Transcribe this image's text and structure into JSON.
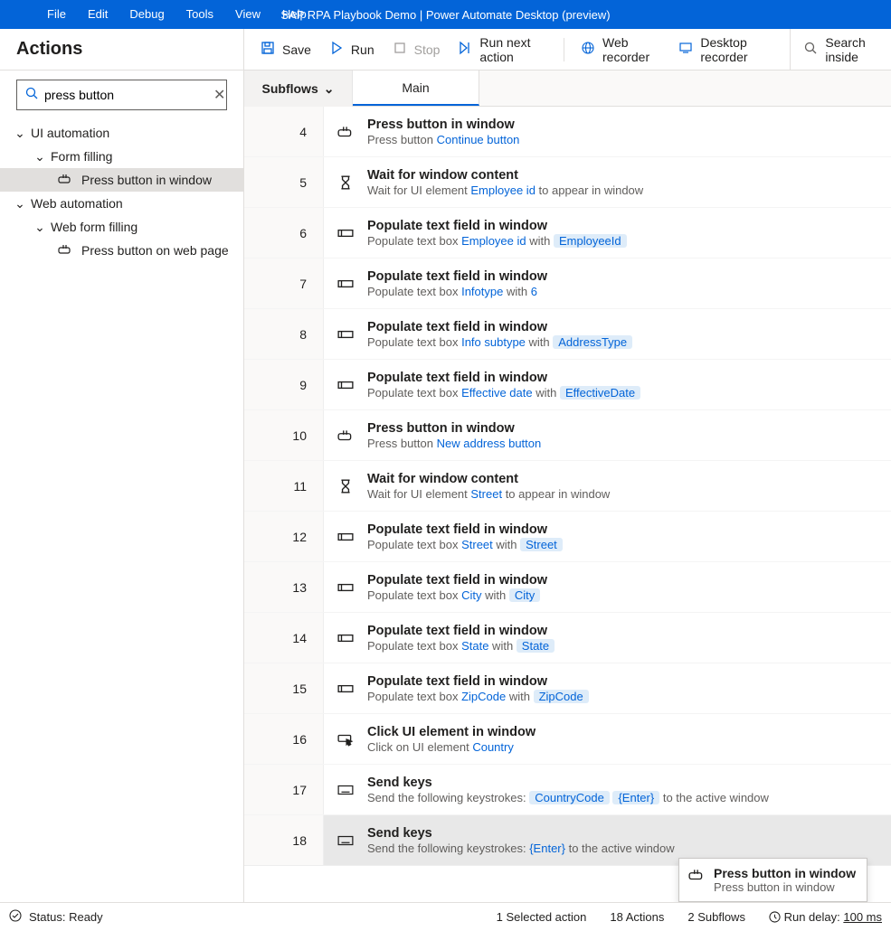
{
  "window": {
    "title": "SAP RPA Playbook Demo | Power Automate Desktop (preview)"
  },
  "menu": {
    "file": "File",
    "edit": "Edit",
    "debug": "Debug",
    "tools": "Tools",
    "view": "View",
    "help": "Help"
  },
  "panel_title": "Actions",
  "toolbar": {
    "save": "Save",
    "run": "Run",
    "stop": "Stop",
    "run_next": "Run next action",
    "web_rec": "Web recorder",
    "desk_rec": "Desktop recorder",
    "search_ph": "Search inside"
  },
  "search": {
    "value": "press button"
  },
  "tree": {
    "ui_auto": "UI automation",
    "form_filling": "Form filling",
    "press_window": "Press button in window",
    "web_auto": "Web automation",
    "web_form_filling": "Web form filling",
    "press_web": "Press button on web page"
  },
  "subflows_label": "Subflows",
  "tab_main": "Main",
  "steps": [
    {
      "n": "4",
      "icon": "press",
      "title": "Press button in window",
      "desc_pre": "Press button ",
      "link": "Continue button"
    },
    {
      "n": "5",
      "icon": "wait",
      "title": "Wait for window content",
      "desc_pre": "Wait for UI element ",
      "link": "Employee id",
      "desc_post": " to appear in window"
    },
    {
      "n": "6",
      "icon": "field",
      "title": "Populate text field in window",
      "desc_pre": "Populate text box ",
      "link": "Employee id",
      "mid": " with ",
      "pill": "EmployeeId"
    },
    {
      "n": "7",
      "icon": "field",
      "title": "Populate text field in window",
      "desc_pre": "Populate text box ",
      "link": "Infotype",
      "mid": " with ",
      "link2": "6"
    },
    {
      "n": "8",
      "icon": "field",
      "title": "Populate text field in window",
      "desc_pre": "Populate text box ",
      "link": "Info subtype",
      "mid": " with ",
      "pill": "AddressType"
    },
    {
      "n": "9",
      "icon": "field",
      "title": "Populate text field in window",
      "desc_pre": "Populate text box ",
      "link": "Effective date",
      "mid": " with ",
      "pill": "EffectiveDate"
    },
    {
      "n": "10",
      "icon": "press",
      "title": "Press button in window",
      "desc_pre": "Press button ",
      "link": "New address button"
    },
    {
      "n": "11",
      "icon": "wait",
      "title": "Wait for window content",
      "desc_pre": "Wait for UI element ",
      "link": "Street",
      "desc_post": " to appear in window"
    },
    {
      "n": "12",
      "icon": "field",
      "title": "Populate text field in window",
      "desc_pre": "Populate text box ",
      "link": "Street",
      "mid": " with ",
      "pill": "Street"
    },
    {
      "n": "13",
      "icon": "field",
      "title": "Populate text field in window",
      "desc_pre": "Populate text box ",
      "link": "City",
      "mid": " with ",
      "pill": "City"
    },
    {
      "n": "14",
      "icon": "field",
      "title": "Populate text field in window",
      "desc_pre": "Populate text box ",
      "link": "State",
      "mid": " with ",
      "pill": "State"
    },
    {
      "n": "15",
      "icon": "field",
      "title": "Populate text field in window",
      "desc_pre": "Populate text box ",
      "link": "ZipCode",
      "mid": " with ",
      "pill": "ZipCode"
    },
    {
      "n": "16",
      "icon": "click",
      "title": "Click UI element in window",
      "desc_pre": "Click on UI element ",
      "link": "Country"
    },
    {
      "n": "17",
      "icon": "keys",
      "title": "Send keys",
      "desc_pre": "Send the following keystrokes: ",
      "pill": "CountryCode",
      "pill2": "{Enter}",
      "desc_post": " to the active window"
    },
    {
      "n": "18",
      "icon": "keys",
      "title": "Send keys",
      "desc_pre": "Send the following keystrokes: ",
      "link": "{Enter}",
      "desc_post": " to the active window",
      "selected": true
    }
  ],
  "tooltip": {
    "title": "Press button in window",
    "desc": "Press button in window"
  },
  "status": {
    "ready": "Status: Ready",
    "selected": "1 Selected action",
    "actions": "18 Actions",
    "subflows": "2 Subflows",
    "delay_lbl": "Run delay:",
    "delay_val": "100 ms"
  }
}
